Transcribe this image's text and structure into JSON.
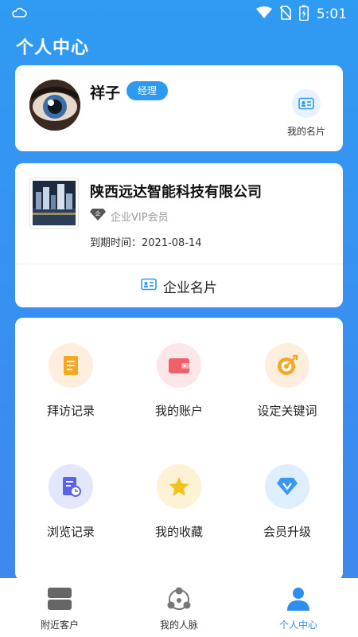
{
  "status_bar": {
    "time": "5:01"
  },
  "header": {
    "title": "个人中心"
  },
  "profile": {
    "name": "祥子",
    "role": "经理",
    "my_card_label": "我的名片"
  },
  "company": {
    "name": "陕西远达智能科技有限公司",
    "vip_label": "企业VIP会员",
    "expire_label": "到期时间：2021-08-14",
    "card_button_label": "企业名片"
  },
  "menu": {
    "items": [
      {
        "label": "拜访记录",
        "icon": "visit-record-icon",
        "color": "#f5a623"
      },
      {
        "label": "我的账户",
        "icon": "wallet-icon",
        "color": "#f0606b"
      },
      {
        "label": "设定关键词",
        "icon": "target-icon",
        "color": "#f5a623"
      },
      {
        "label": "浏览记录",
        "icon": "browse-record-icon",
        "color": "#5b63e6"
      },
      {
        "label": "我的收藏",
        "icon": "star-icon",
        "color": "#f5c21b"
      },
      {
        "label": "会员升级",
        "icon": "diamond-icon",
        "color": "#3a98f0"
      }
    ]
  },
  "tabs": [
    {
      "label": "附近客户",
      "active": false
    },
    {
      "label": "我的人脉",
      "active": false
    },
    {
      "label": "个人中心",
      "active": true
    }
  ],
  "colors": {
    "accent": "#2d9af2",
    "background": "#3a8ef0"
  }
}
